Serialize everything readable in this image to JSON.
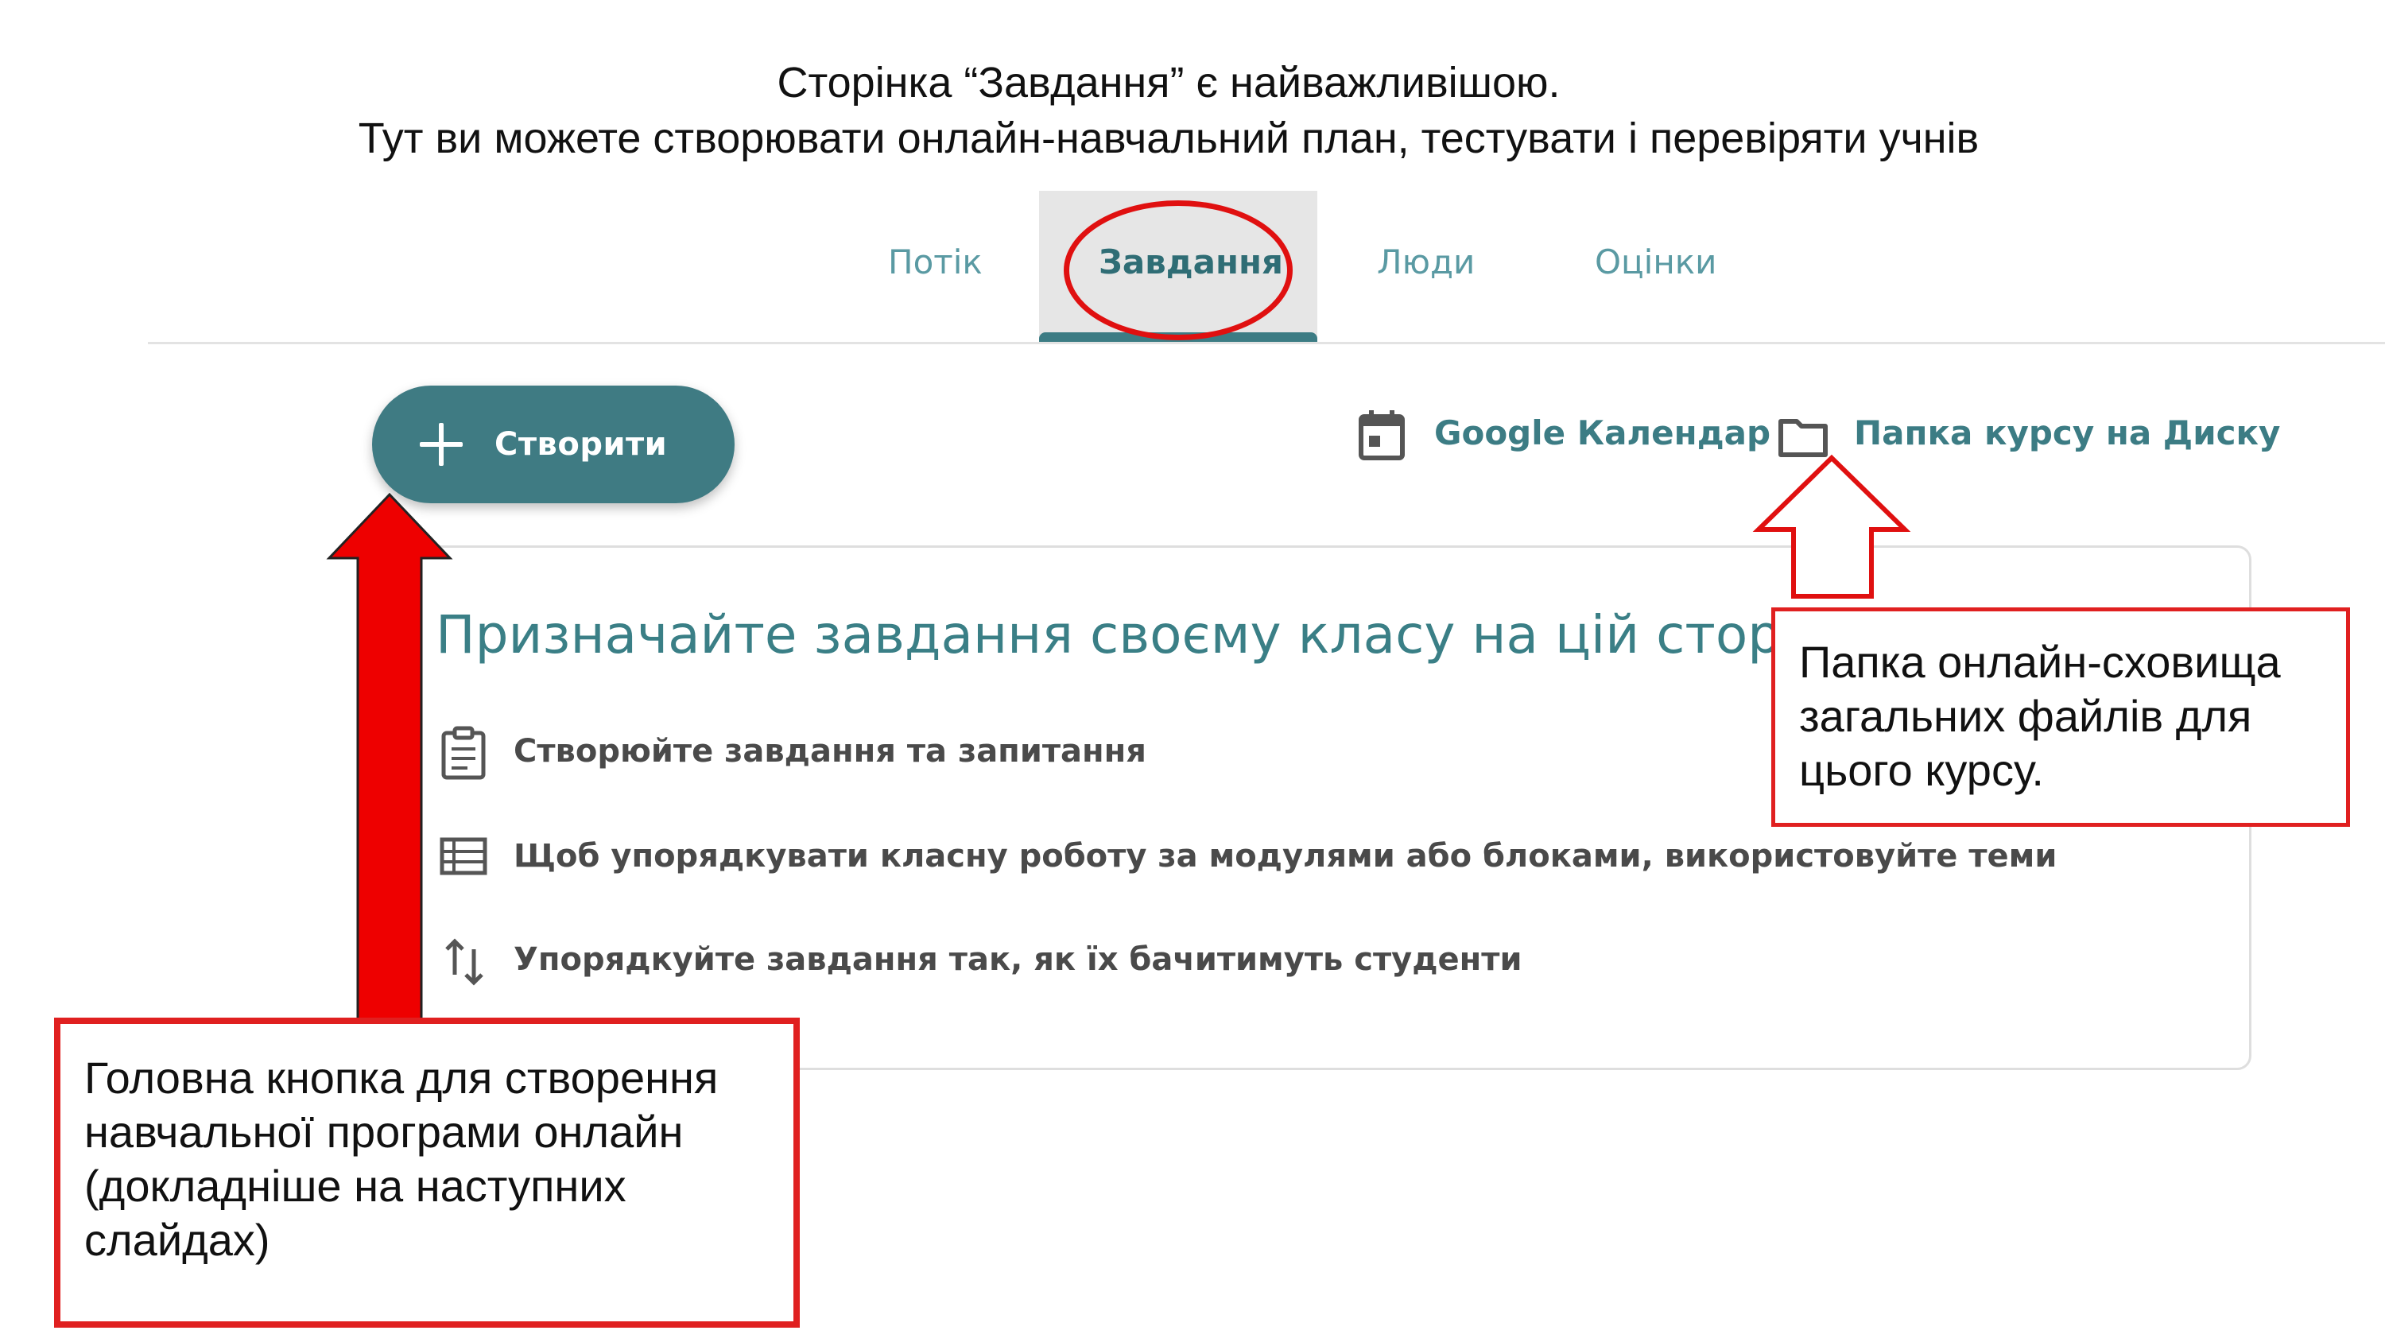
{
  "slide": {
    "title_line1": "Сторінка “Завдання” є найважливішою.",
    "title_line2": "Тут ви можете створювати онлайн-навчальний план, тестувати і перевіряти учнів"
  },
  "tabs": [
    {
      "label": "Потік",
      "active": false
    },
    {
      "label": "Завдання",
      "active": true
    },
    {
      "label": "Люди",
      "active": false
    },
    {
      "label": "Оцінки",
      "active": false
    }
  ],
  "toolbar": {
    "create_label": "Створити",
    "calendar_label": "Google Календар",
    "drive_label": "Папка курсу на Диску"
  },
  "card": {
    "title": "Призначайте завдання своєму класу на цій сторінці",
    "rows": [
      {
        "icon": "assignment-icon",
        "text": "Створюйте завдання та запитання"
      },
      {
        "icon": "topic-list-icon",
        "text": "Щоб упорядкувати класну роботу за модулями або блоками, використовуйте теми"
      },
      {
        "icon": "reorder-arrows-icon",
        "text": "Упорядкуйте завдання так, як їх бачитимуть студенти"
      }
    ]
  },
  "annotations": {
    "drive_note": [
      "Папка онлайн-сховища",
      "загальних файлів для",
      "цього курсу."
    ],
    "create_note": [
      "Головна кнопка для створення",
      "навчальної програми онлайн",
      "(докладніше на наступних",
      "слайдах)"
    ]
  },
  "colors": {
    "accent": "#3f7b83",
    "tab_text": "#5a9aa3",
    "annotation_red": "#e02020"
  }
}
